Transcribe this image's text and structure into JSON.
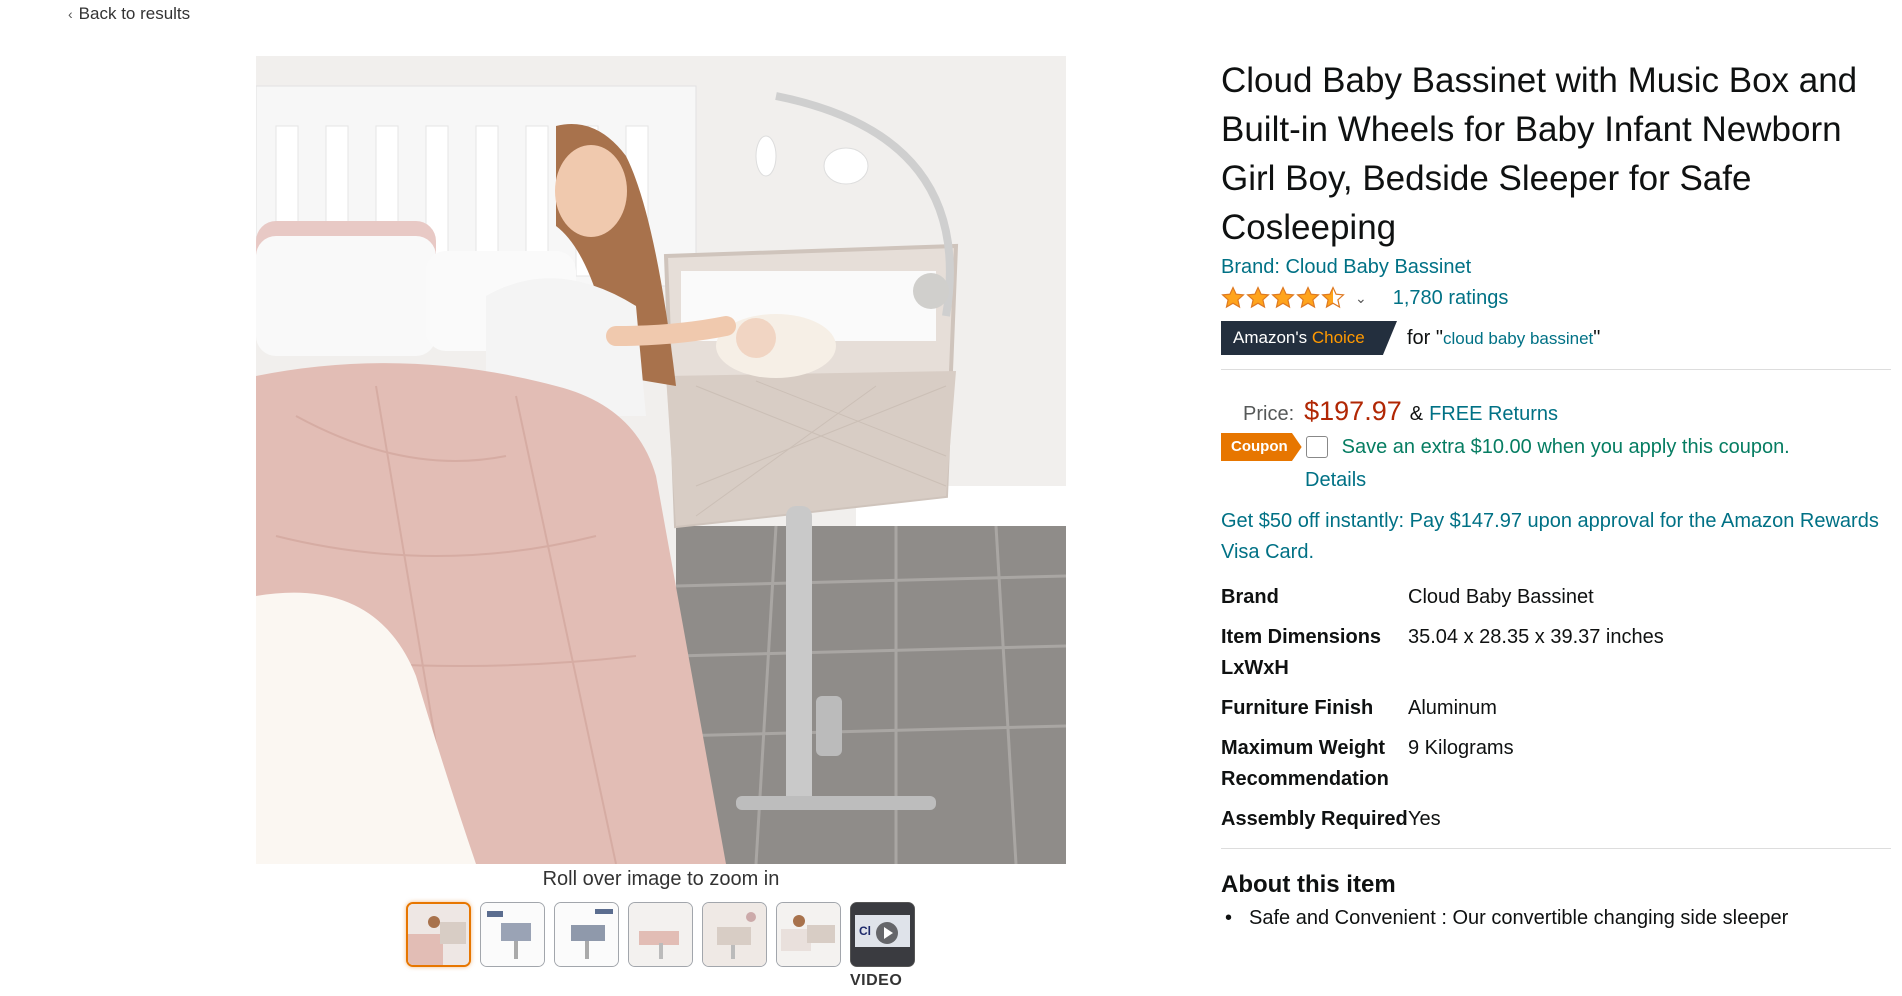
{
  "nav": {
    "back_label": "Back to results"
  },
  "gallery": {
    "zoom_hint": "Roll over image to zoom in",
    "video_label": "VIDEO",
    "play_text": "Cl"
  },
  "product": {
    "title": "Cloud Baby Bassinet with Music Box and Built-in Wheels for Baby Infant Newborn Girl Boy, Bedside Sleeper for Safe Cosleeping",
    "brand_link": "Brand: Cloud Baby Bassinet",
    "rating_value": 4.5,
    "ratings_count": "1,780 ratings",
    "choice_badge": {
      "prefix": "Amazon's",
      "accent": "Choice"
    },
    "choice_for": {
      "lead": "for \"",
      "keyword": "cloud baby bassinet",
      "tail": "\""
    }
  },
  "pricing": {
    "price_label": "Price:",
    "price": "$197.97",
    "amp": "&",
    "free_returns": "FREE Returns",
    "coupon_badge": "Coupon",
    "coupon_text": "Save an extra $10.00 when you apply this coupon.",
    "details_link": "Details",
    "visa_offer": "Get $50 off instantly: Pay $147.97 upon approval for the Amazon Rewards Visa Card."
  },
  "specs": [
    {
      "key": "Brand",
      "value": "Cloud Baby Bassinet"
    },
    {
      "key": "Item Dimensions LxWxH",
      "value": "35.04 x 28.35 x 39.37 inches"
    },
    {
      "key": "Furniture Finish",
      "value": "Aluminum"
    },
    {
      "key": "Maximum Weight Recommendation",
      "value": "9 Kilograms"
    },
    {
      "key": "Assembly Required",
      "value": "Yes"
    }
  ],
  "about": {
    "title": "About this item",
    "bullets": [
      "Safe and Convenient : Our convertible changing side sleeper"
    ]
  },
  "colors": {
    "link": "#007185",
    "price": "#b12704",
    "coupon_bg": "#e77600",
    "coupon_text": "#067d62",
    "badge_bg": "#232f3e",
    "badge_accent": "#ff9900",
    "star": "#ffa41c"
  }
}
